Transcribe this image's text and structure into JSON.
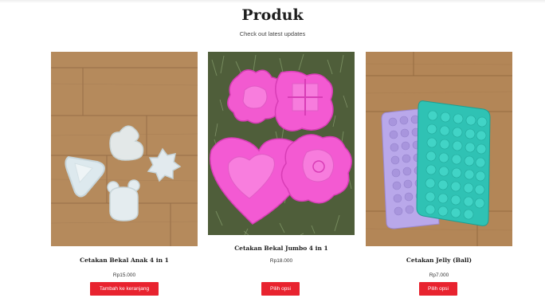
{
  "header": {
    "title": "Produk",
    "subtitle": "Check out latest updates"
  },
  "products": [
    {
      "name": "Cetakan Bekal Anak 4 in 1",
      "price": "Rp15.000",
      "button": "Tambah ke keranjang",
      "image": "white plastic molds on wooden floor"
    },
    {
      "name": "Cetakan Bekal Jumbo 4 in 1",
      "price": "Rp18.000",
      "button": "Pilih opsi",
      "image": "pink plastic molds on grass"
    },
    {
      "name": "Cetakan Jelly (Ball)",
      "price": "Rp7.000",
      "button": "Pilih opsi",
      "image": "purple and teal ball molds on wooden floor"
    }
  ],
  "colors": {
    "button": "#e8232f",
    "wood": "#b58a5c",
    "grass": "#4f5e3a",
    "pink": "#f25ad0",
    "purple": "#b7a6e8",
    "teal": "#2fc2b4"
  }
}
